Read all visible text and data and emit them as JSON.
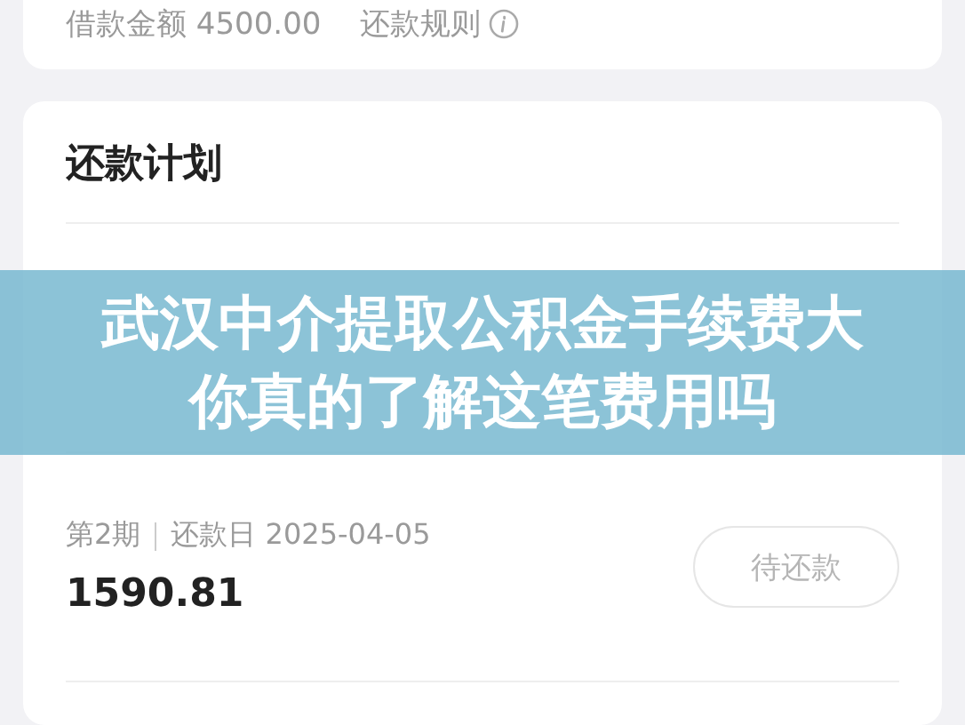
{
  "loan_card": {
    "amount_label": "借款金额 4500.00",
    "rules_link": "还款规则"
  },
  "plan": {
    "title": "还款计划",
    "installments": [
      {
        "period": "第2期",
        "due_date": "还款日 2025-04-05",
        "amount": "1590.81",
        "button_label": "待还款"
      }
    ]
  },
  "banner": {
    "lines": [
      "武汉中介提取公积金手续费大",
      "你真的了解这笔费用吗"
    ]
  }
}
